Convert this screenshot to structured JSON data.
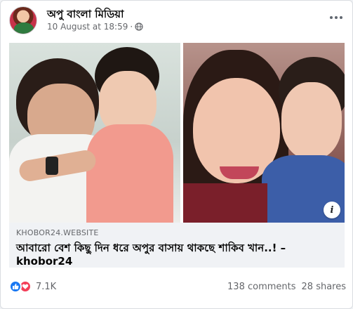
{
  "post": {
    "page_name": "অপু বাংলা মিডিয়া",
    "timestamp": "10 August at 18:59",
    "separator": "·",
    "privacy_icon": "globe-icon",
    "more_icon": "more-options-icon"
  },
  "media": {
    "info_label": "i"
  },
  "link": {
    "domain": "KHOBOR24.WEBSITE",
    "title": "আবারো বেশ কিছু দিন ধরে অপুর বাসায় থাকছে শাকিব খান..! – khobor24"
  },
  "footer": {
    "reaction_icons": [
      "like-icon",
      "love-icon"
    ],
    "reaction_count": "7.1K",
    "comments": "138 comments",
    "shares": "28 shares"
  },
  "colors": {
    "like": "#1877f2",
    "love": "#f33e58",
    "secondary_text": "#65676b",
    "link_bg": "#f0f2f5"
  }
}
